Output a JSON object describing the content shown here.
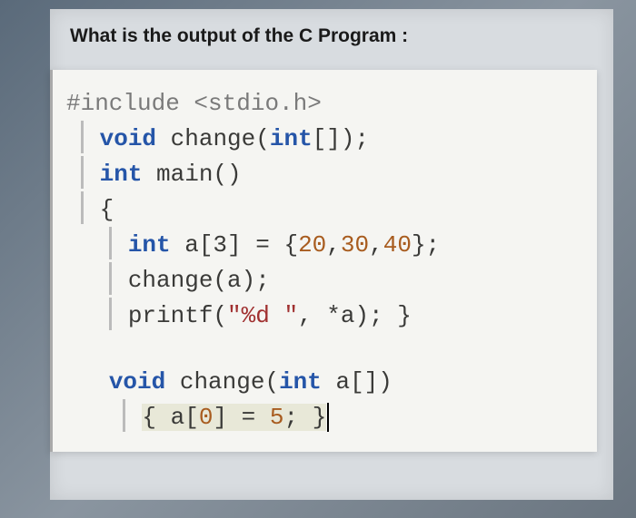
{
  "question": "What is the output of the C Program :",
  "code": {
    "line1_preproc": "#include",
    "line1_rest": " <stdio.h>",
    "line2_void": "void",
    "line2_fn": " change(",
    "line2_int": "int",
    "line2_end": "[]);",
    "line3_int": "int",
    "line3_main": " main()",
    "line4_brace": "{",
    "line5_int": "int",
    "line5_decl": " a[3] = {",
    "line5_n1": "20",
    "line5_c1": ",",
    "line5_n2": "30",
    "line5_c2": ",",
    "line5_n3": "40",
    "line5_end": "};",
    "line6": "change(a);",
    "line7_fn": "printf(",
    "line7_str": "\"%d \"",
    "line7_end": ", *a); }",
    "line9_void": "void",
    "line9_fn": " change(",
    "line9_int": "int",
    "line9_end": " a[])",
    "line10_open": "{ a[",
    "line10_idx": "0",
    "line10_mid": "] = ",
    "line10_val": "5",
    "line10_end": "; }"
  }
}
